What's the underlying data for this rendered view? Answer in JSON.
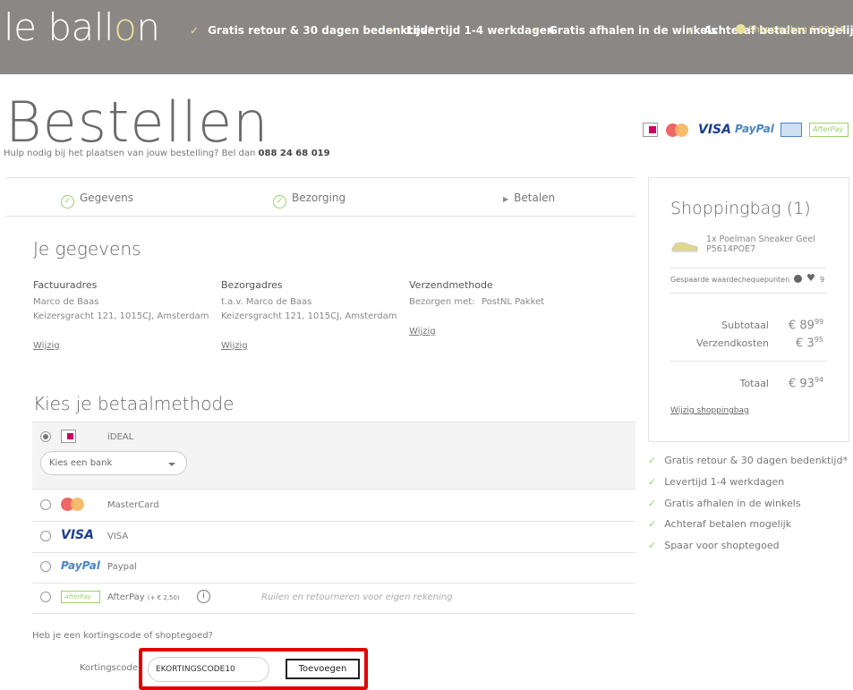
{
  "header": {
    "logo_pre": "le ball",
    "logo_o": "o",
    "logo_post": "n",
    "usps": [
      "Gratis retour & 30 dagen bedenktijd*",
      "Levertijd 1-4 werkdagen",
      "Gratis afhalen in de winkels",
      "Achteraf betalen mogelijk"
    ],
    "cart_text": "Shoppingbag € 93,94",
    "check": "✓"
  },
  "page": {
    "title": "Bestellen",
    "help_prefix": "Hulp nodig bij het plaatsen van jouw bestelling? Bel dan",
    "help_phone": "088 24 68 019"
  },
  "payment_logos": [
    "iDEAL",
    "MasterCard",
    "VISA",
    "PayPal",
    "Bancontact",
    "AfterPay"
  ],
  "steps": [
    {
      "label": "Gegevens",
      "done": true
    },
    {
      "label": "Bezorging",
      "done": true
    },
    {
      "label": "Betalen",
      "done": false
    }
  ],
  "details": {
    "heading": "Je gegevens",
    "billing": {
      "title": "Factuuradres",
      "name": "Marco de Baas",
      "address": "Keizersgracht 121, 1015CJ, Amsterdam",
      "edit": "Wijzig"
    },
    "delivery": {
      "title": "Bezorgadres",
      "name": "t.a.v. Marco de Baas",
      "address": "Keizersgracht 121, 1015CJ, Amsterdam",
      "edit": "Wijzig"
    },
    "shipping": {
      "title": "Verzendmethode",
      "label": "Bezorgen met:",
      "value": "PostNL Pakket",
      "edit": "Wijzig"
    }
  },
  "payment": {
    "heading": "Kies je betaalmethode",
    "bank_placeholder": "Kies een bank",
    "methods": [
      {
        "name": "iDEAL",
        "logo": "iDEAL",
        "selected": true
      },
      {
        "name": "MasterCard",
        "logo": "mastercard",
        "selected": false
      },
      {
        "name": "VISA",
        "logo": "VISA",
        "selected": false
      },
      {
        "name": "Paypal",
        "logo": "PayPal",
        "selected": false
      },
      {
        "name": "AfterPay",
        "logo": "AfterPay",
        "fee": "(+ € 2,50)",
        "info": "i",
        "note": "Ruilen en retourneren voor eigen rekening",
        "selected": false
      }
    ]
  },
  "discount": {
    "question": "Heb je een kortingscode of shoptegoed?",
    "label": "Kortingscode",
    "value": "EKORTINGSCODE10",
    "button": "Toevoegen"
  },
  "bag": {
    "title": "Shoppingbag (1)",
    "product_line1": "1x Poelman Sneaker Geel",
    "product_line2": "P5614POE7",
    "points_label": "Gespaarde waardechequepunten",
    "points": "9",
    "subtotal_label": "Subtotaal",
    "subtotal_main": "€ 89",
    "subtotal_cents": "99",
    "shipping_label": "Verzendkosten",
    "shipping_main": "€ 3",
    "shipping_cents": "95",
    "total_label": "Totaal",
    "total_main": "€ 93",
    "total_cents": "94",
    "edit_link": "Wijzig shoppingbag"
  },
  "side_usps": [
    "Gratis retour & 30 dagen bedenktijd*",
    "Levertijd 1-4 werkdagen",
    "Gratis afhalen in de winkels",
    "Achteraf betalen mogelijk",
    "Spaar voor shoptegoed"
  ],
  "colors": {
    "accent_yellow": "#e9e29a",
    "check_green": "#9dcf6b",
    "header_bg": "#8a8784",
    "highlight_red": "#e00000"
  }
}
